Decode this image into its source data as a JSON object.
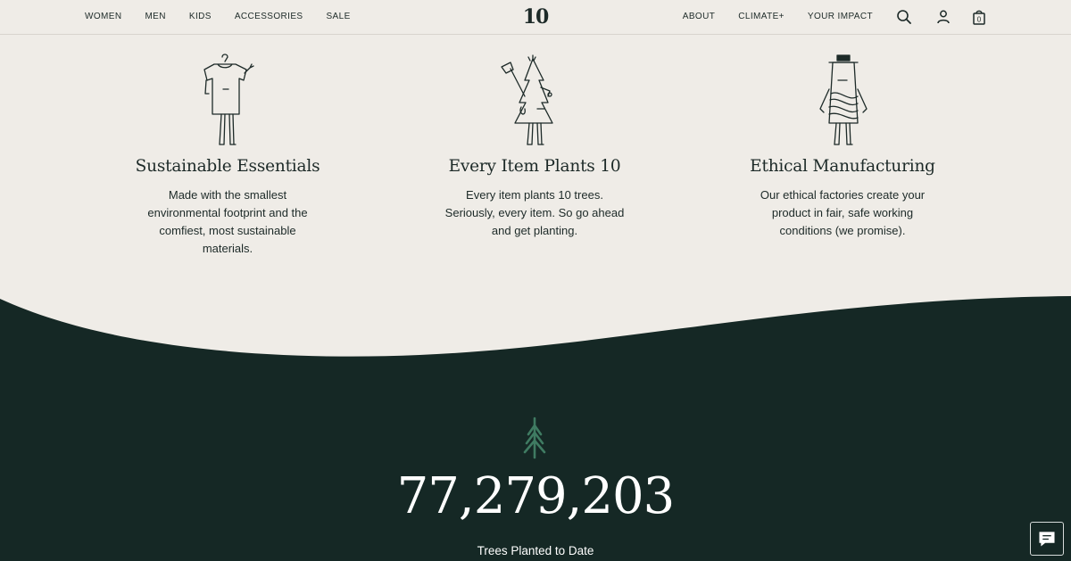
{
  "nav": {
    "left": [
      "WOMEN",
      "MEN",
      "KIDS",
      "ACCESSORIES",
      "SALE"
    ],
    "right": [
      "ABOUT",
      "CLIMATE+",
      "YOUR IMPACT"
    ],
    "logo": "10",
    "cart_count": "0"
  },
  "features": [
    {
      "title": "Sustainable Essentials",
      "text": "Made with the smallest environmental footprint and the comfiest, most sustainable materials."
    },
    {
      "title": "Every Item Plants 10",
      "text": "Every item plants 10 trees. Seriously, every item. So go ahead and get planting."
    },
    {
      "title": "Ethical Manufacturing",
      "text": "Our ethical factories create your product in fair, safe working conditions (we promise)."
    }
  ],
  "impact": {
    "count": "77,279,203",
    "label": "Trees Planted to Date"
  },
  "colors": {
    "background": "#efece7",
    "dark": "#152825",
    "text": "#1d2a28",
    "tree_accent": "#3f7b62"
  },
  "icons": [
    "search-icon",
    "account-icon",
    "cart-icon",
    "tree-icon",
    "chat-icon"
  ]
}
